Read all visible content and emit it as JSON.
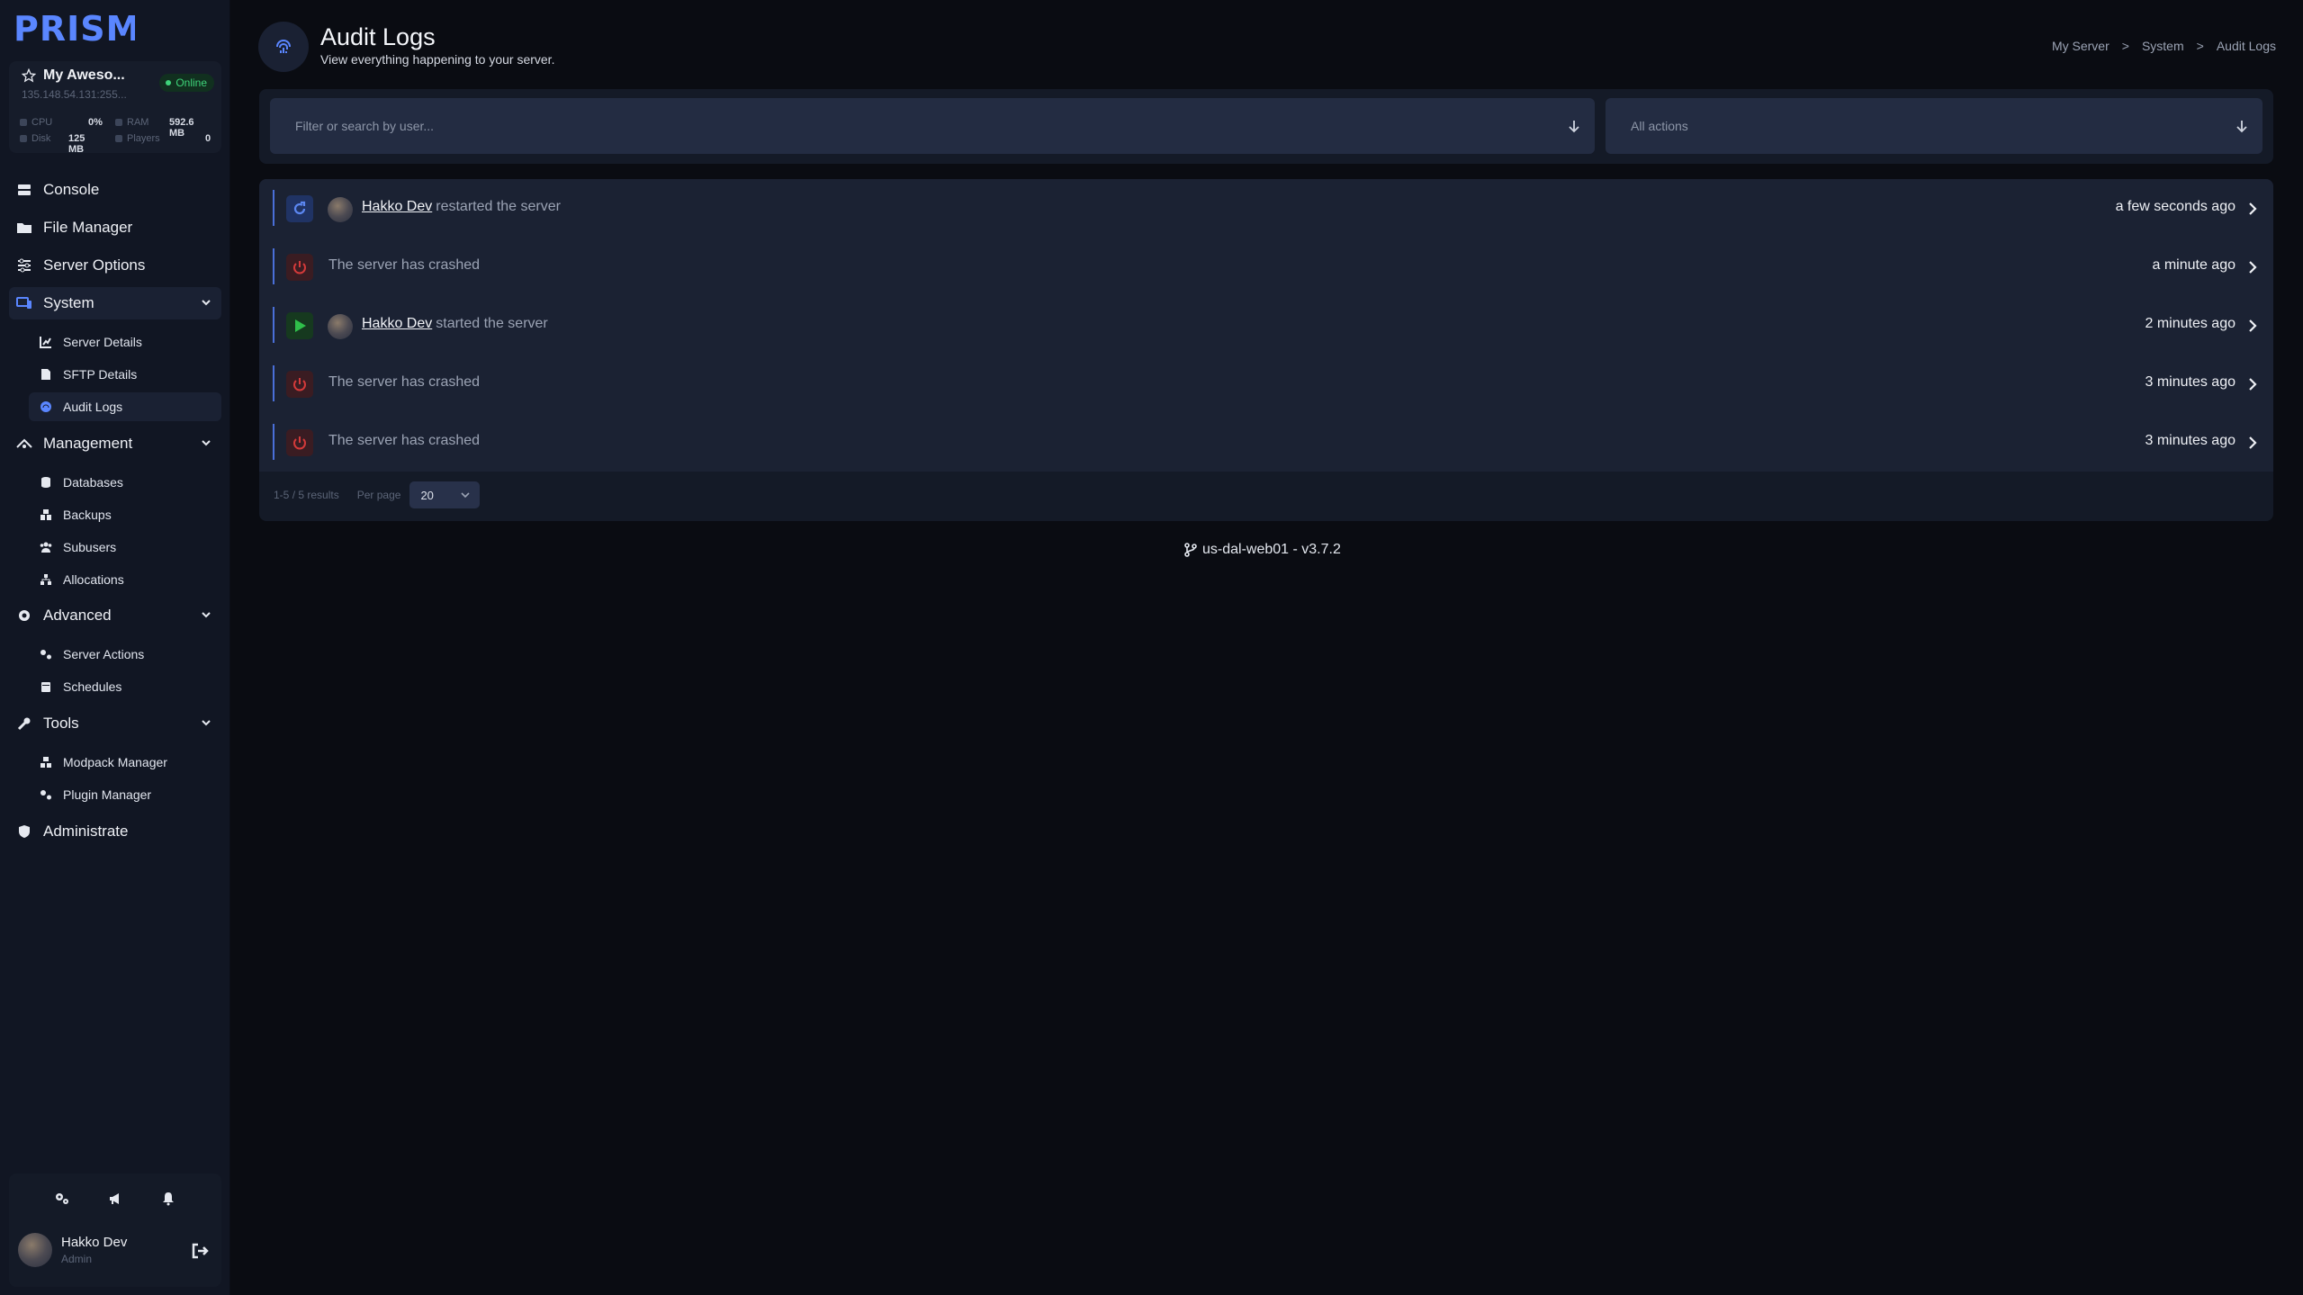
{
  "brand": {
    "logo_text": "PRISM"
  },
  "server": {
    "name": "My Aweso...",
    "ip": "135.148.54.131:255...",
    "status": "Online",
    "stats": {
      "cpu_label": "CPU",
      "cpu_value": "0%",
      "ram_label": "RAM",
      "ram_value": "592.6 MB",
      "disk_label": "Disk",
      "disk_value": "125 MB",
      "players_label": "Players",
      "players_value": "0"
    }
  },
  "sidebar": {
    "console": "Console",
    "file_manager": "File Manager",
    "server_options": "Server Options",
    "system": "System",
    "system_items": [
      "Server Details",
      "SFTP Details",
      "Audit Logs"
    ],
    "management": "Management",
    "management_items": [
      "Databases",
      "Backups",
      "Subusers",
      "Allocations"
    ],
    "advanced": "Advanced",
    "advanced_items": [
      "Server Actions",
      "Schedules"
    ],
    "tools": "Tools",
    "tools_items": [
      "Modpack Manager",
      "Plugin Manager"
    ],
    "administrate": "Administrate"
  },
  "user": {
    "name": "Hakko Dev",
    "role": "Admin"
  },
  "header": {
    "title": "Audit Logs",
    "subtitle": "View everything happening to your server.",
    "breadcrumb": [
      "My Server",
      ">",
      "System",
      ">",
      "Audit Logs"
    ]
  },
  "filters": {
    "search_placeholder": "Filter or search by user...",
    "action_value": "All actions"
  },
  "logs": [
    {
      "type": "restart",
      "user": "Hakko Dev",
      "message": "restarted the server",
      "time": "a few seconds ago"
    },
    {
      "type": "crash",
      "user": "",
      "message": "The server has crashed",
      "time": "a minute ago"
    },
    {
      "type": "start",
      "user": "Hakko Dev",
      "message": "started the server",
      "time": "2 minutes ago"
    },
    {
      "type": "crash",
      "user": "",
      "message": "The server has crashed",
      "time": "3 minutes ago"
    },
    {
      "type": "crash",
      "user": "",
      "message": "The server has crashed",
      "time": "3 minutes ago"
    }
  ],
  "pagination": {
    "range": "1-5",
    "sep": "/",
    "results": "5 results",
    "per_page_label": "Per page",
    "per_page_value": "20"
  },
  "footer": {
    "version": "us-dal-web01 - v3.7.2"
  },
  "colors": {
    "accent": "#4a6fd8",
    "online": "#3ed47a",
    "crash": "#d33a3a",
    "start": "#2fbf4a",
    "restart": "#5b86f0"
  }
}
